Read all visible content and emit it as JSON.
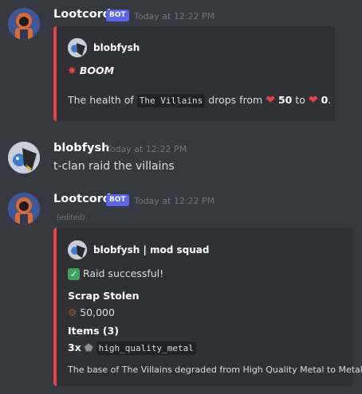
{
  "messages": [
    {
      "username": "Lootcord",
      "bot_tag": "BOT",
      "timestamp": "Today at 12:22 PM",
      "embed": {
        "author": "blobfysh",
        "title": "BOOM",
        "title_icon": "collision-icon",
        "health_prefix": "The health of",
        "clan": "The Villains",
        "health_mid": "drops from",
        "from_value": "50",
        "health_to": "to",
        "to_value": "0",
        "health_end": ".",
        "accent": "#ed4245"
      }
    },
    {
      "username": "blobfysh",
      "timestamp": "Today at 12:22 PM",
      "text": "t-clan raid the villains"
    },
    {
      "username": "Lootcord",
      "bot_tag": "BOT",
      "timestamp": "Today at 12:22 PM",
      "edited": "(edited)",
      "embed": {
        "author": "blobfysh | mod squad",
        "status": "Raid successful!",
        "status_icon": "check-mark-icon",
        "scrap_title": "Scrap Stolen",
        "scrap_value": "50,000",
        "items_title": "Items (3)",
        "item_qty": "3x",
        "item_name": "high_quality_metal",
        "footer": "The base of The Villains degraded from High Quality Metal to Metal.",
        "accent": "#ed4245"
      }
    }
  ],
  "colors": {
    "background": "#36393f",
    "embed_bg": "#2f3136",
    "bot_tag": "#5865f2",
    "timestamp": "#72767d"
  }
}
